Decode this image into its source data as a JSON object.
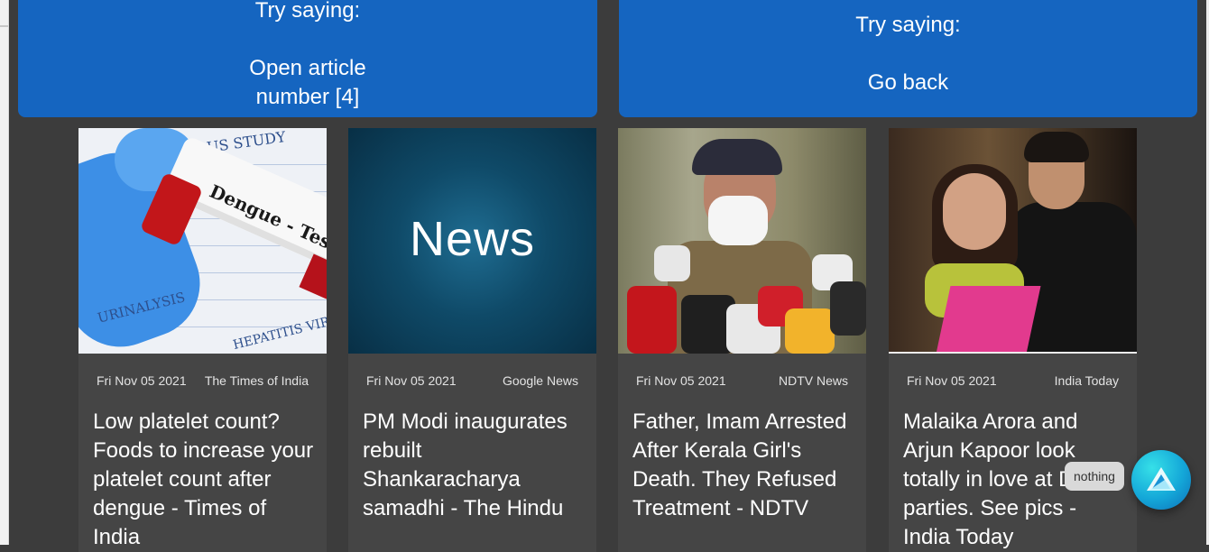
{
  "hints": {
    "left": {
      "heading": "Try saying:",
      "command": "Open article number [4]"
    },
    "right": {
      "heading": "Try saying:",
      "command": "Go back"
    }
  },
  "articles": [
    {
      "date": "Fri Nov 05 2021",
      "source": "The Times of India",
      "title": "Low platelet count? Foods to increase your platelet count after dengue - Times of India",
      "image_text": "Dengue - Test",
      "image_text_2": "VIRUS STUDY",
      "image_text_3": "URINALYSIS",
      "image_text_4": "HEPATITIS VIR"
    },
    {
      "date": "Fri Nov 05 2021",
      "source": "Google News",
      "title": "PM Modi inaugurates rebuilt Shankaracharya samadhi - The Hindu",
      "image_text": "News"
    },
    {
      "date": "Fri Nov 05 2021",
      "source": "NDTV News",
      "title": "Father, Imam Arrested After Kerala Girl's Death. They Refused Treatment - NDTV"
    },
    {
      "date": "Fri Nov 05 2021",
      "source": "India Today",
      "title": "Malaika Arora and Arjun Kapoor look totally in love at Diwali parties. See pics - India Today"
    }
  ],
  "assistant": {
    "tooltip": "nothing",
    "icon": "assistant-logo-icon"
  },
  "colors": {
    "banner": "#1565c0",
    "background": "#3c3c3c",
    "card": "#454545",
    "fab": "#14a7d8"
  }
}
